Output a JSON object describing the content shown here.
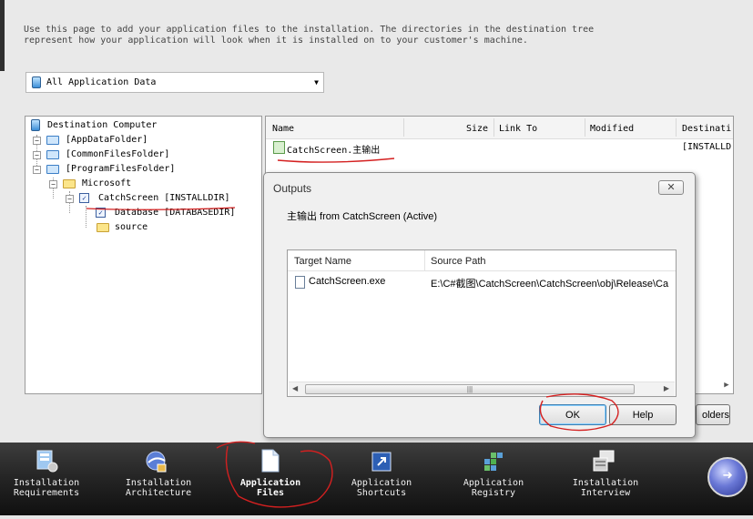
{
  "description": {
    "line1": "Use this page to add your application files to the installation. The directories in the destination tree",
    "line2": "represent how your application will look when it is installed on to your customer's machine."
  },
  "data_selector": {
    "selected": "All Application Data"
  },
  "tree": {
    "root": "Destination Computer",
    "items": [
      "[AppDataFolder]",
      "[CommonFilesFolder]",
      "[ProgramFilesFolder]",
      "Microsoft",
      "CatchScreen [INSTALLDIR]",
      "Database [DATABASEDIR]",
      "source"
    ]
  },
  "files": {
    "columns": [
      "Name",
      "Size",
      "Link To",
      "Modified",
      "Destinati"
    ],
    "rows": [
      {
        "name": "CatchScreen.主输出",
        "destination": "[INSTALLD"
      }
    ]
  },
  "dialog": {
    "title": "Outputs",
    "close_label": "✕",
    "subtitle": "主输出 from CatchScreen (Active)",
    "columns": [
      "Target Name",
      "Source Path"
    ],
    "rows": [
      {
        "target": "CatchScreen.exe",
        "source": "E:\\C#截图\\CatchScreen\\CatchScreen\\obj\\Release\\Ca"
      }
    ],
    "ok_label": "OK",
    "help_label": "Help"
  },
  "folders_button": {
    "label": "olders"
  },
  "nav": {
    "items": [
      {
        "label": "Installation\nRequirements",
        "icon": "requirements-icon"
      },
      {
        "label": "Installation\nArchitecture",
        "icon": "architecture-icon"
      },
      {
        "label": "Application\nFiles",
        "icon": "files-icon"
      },
      {
        "label": "Application\nShortcuts",
        "icon": "shortcut-icon"
      },
      {
        "label": "Application\nRegistry",
        "icon": "registry-icon"
      },
      {
        "label": "Installation\nInterview",
        "icon": "interview-icon"
      }
    ],
    "active_index": 2
  },
  "colors": {
    "annotation": "#d42020",
    "nav_background": "#262626",
    "accent": "#3c7fb1"
  }
}
